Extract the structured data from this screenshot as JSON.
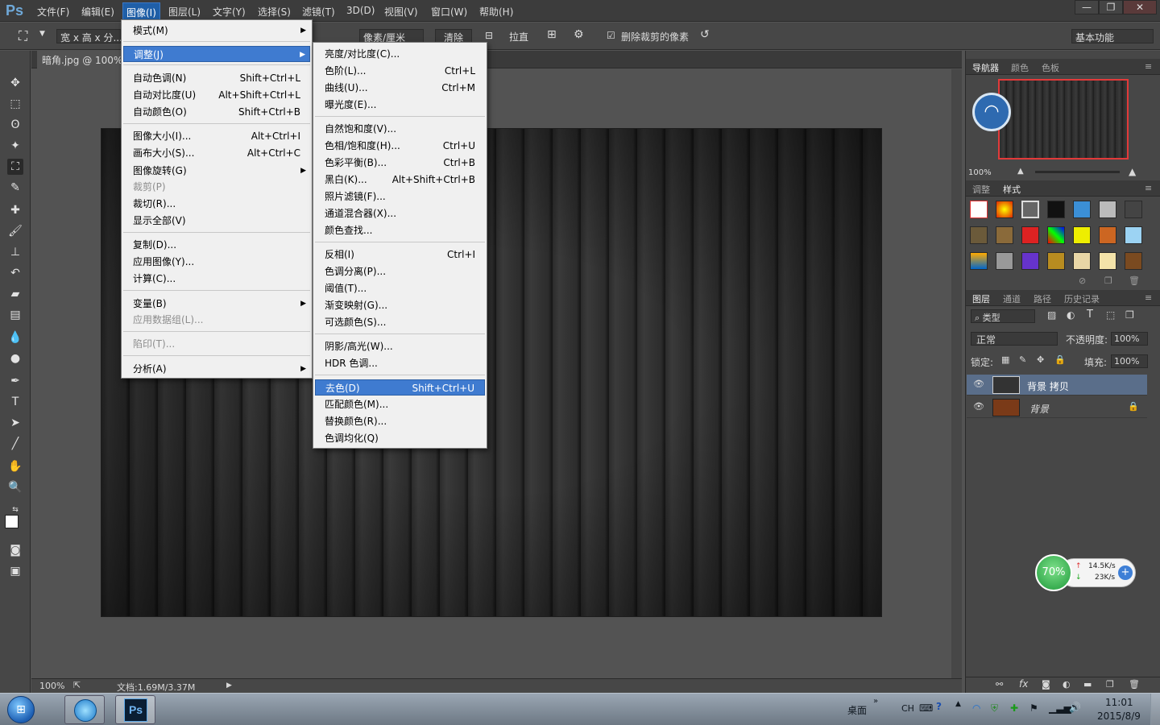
{
  "app": {
    "logo": "Ps"
  },
  "menubar": {
    "items": [
      "文件(F)",
      "编辑(E)",
      "图像(I)",
      "图层(L)",
      "文字(Y)",
      "选择(S)",
      "滤镜(T)",
      "3D(D)",
      "视图(V)",
      "窗口(W)",
      "帮助(H)"
    ],
    "active": "图像(I)",
    "window_buttons": [
      "—",
      "❐",
      "✕"
    ]
  },
  "options_bar": {
    "ratio": "宽 x 高 x 分...",
    "unit": "像素/厘米",
    "clear": "清除",
    "straighten": "拉直",
    "delete_cropped": "删除裁剪的像素",
    "workspace": "基本功能"
  },
  "document": {
    "tab": "暗角.jpg @ 100%",
    "zoom": "100%",
    "doc_info": "文档:1.69M/3.37M"
  },
  "image_menu": [
    {
      "label": "模式(M)",
      "sub": true
    },
    {
      "label": "调整(J)",
      "sub": true,
      "highlight": true
    },
    {
      "label": "自动色调(N)",
      "shortcut": "Shift+Ctrl+L"
    },
    {
      "label": "自动对比度(U)",
      "shortcut": "Alt+Shift+Ctrl+L"
    },
    {
      "label": "自动颜色(O)",
      "shortcut": "Shift+Ctrl+B"
    },
    {
      "label": "图像大小(I)...",
      "shortcut": "Alt+Ctrl+I"
    },
    {
      "label": "画布大小(S)...",
      "shortcut": "Alt+Ctrl+C"
    },
    {
      "label": "图像旋转(G)",
      "sub": true
    },
    {
      "label": "裁剪(P)",
      "disabled": true
    },
    {
      "label": "裁切(R)..."
    },
    {
      "label": "显示全部(V)"
    },
    {
      "label": "复制(D)..."
    },
    {
      "label": "应用图像(Y)..."
    },
    {
      "label": "计算(C)..."
    },
    {
      "label": "变量(B)",
      "sub": true
    },
    {
      "label": "应用数据组(L)...",
      "disabled": true
    },
    {
      "label": "陷印(T)...",
      "disabled": true
    },
    {
      "label": "分析(A)",
      "sub": true
    }
  ],
  "adjust_menu": [
    {
      "label": "亮度/对比度(C)..."
    },
    {
      "label": "色阶(L)...",
      "shortcut": "Ctrl+L"
    },
    {
      "label": "曲线(U)...",
      "shortcut": "Ctrl+M"
    },
    {
      "label": "曝光度(E)..."
    },
    {
      "label": "自然饱和度(V)..."
    },
    {
      "label": "色相/饱和度(H)...",
      "shortcut": "Ctrl+U"
    },
    {
      "label": "色彩平衡(B)...",
      "shortcut": "Ctrl+B"
    },
    {
      "label": "黑白(K)...",
      "shortcut": "Alt+Shift+Ctrl+B"
    },
    {
      "label": "照片滤镜(F)..."
    },
    {
      "label": "通道混合器(X)..."
    },
    {
      "label": "颜色查找..."
    },
    {
      "label": "反相(I)",
      "shortcut": "Ctrl+I"
    },
    {
      "label": "色调分离(P)..."
    },
    {
      "label": "阈值(T)..."
    },
    {
      "label": "渐变映射(G)..."
    },
    {
      "label": "可选颜色(S)..."
    },
    {
      "label": "阴影/高光(W)..."
    },
    {
      "label": "HDR 色调..."
    },
    {
      "label": "去色(D)",
      "shortcut": "Shift+Ctrl+U",
      "highlight": true
    },
    {
      "label": "匹配颜色(M)..."
    },
    {
      "label": "替换颜色(R)..."
    },
    {
      "label": "色调均化(Q)"
    }
  ],
  "navigator": {
    "tabs": [
      "导航器",
      "颜色",
      "色板"
    ],
    "zoom": "100%"
  },
  "styles_panel": {
    "tabs": [
      "调整",
      "样式"
    ]
  },
  "layers_panel": {
    "tabs": [
      "图层",
      "通道",
      "路径",
      "历史记录"
    ],
    "filter": "类型",
    "blend_mode": "正常",
    "opacity_label": "不透明度:",
    "opacity": "100%",
    "lock_label": "锁定:",
    "fill_label": "填充:",
    "fill": "100%",
    "layers": [
      {
        "name": "背景 拷贝",
        "selected": true
      },
      {
        "name": "背景",
        "locked": true
      }
    ]
  },
  "net_widget": {
    "percent": "70%",
    "up": "14.5K/s",
    "down": "23K/s"
  },
  "taskbar": {
    "desktop": "桌面",
    "lang": "CH",
    "time": "11:01",
    "date": "2015/8/9"
  },
  "colors": {
    "highlight": "#3f7bd0",
    "panel": "#474747",
    "canvas_bg": "#535353"
  }
}
